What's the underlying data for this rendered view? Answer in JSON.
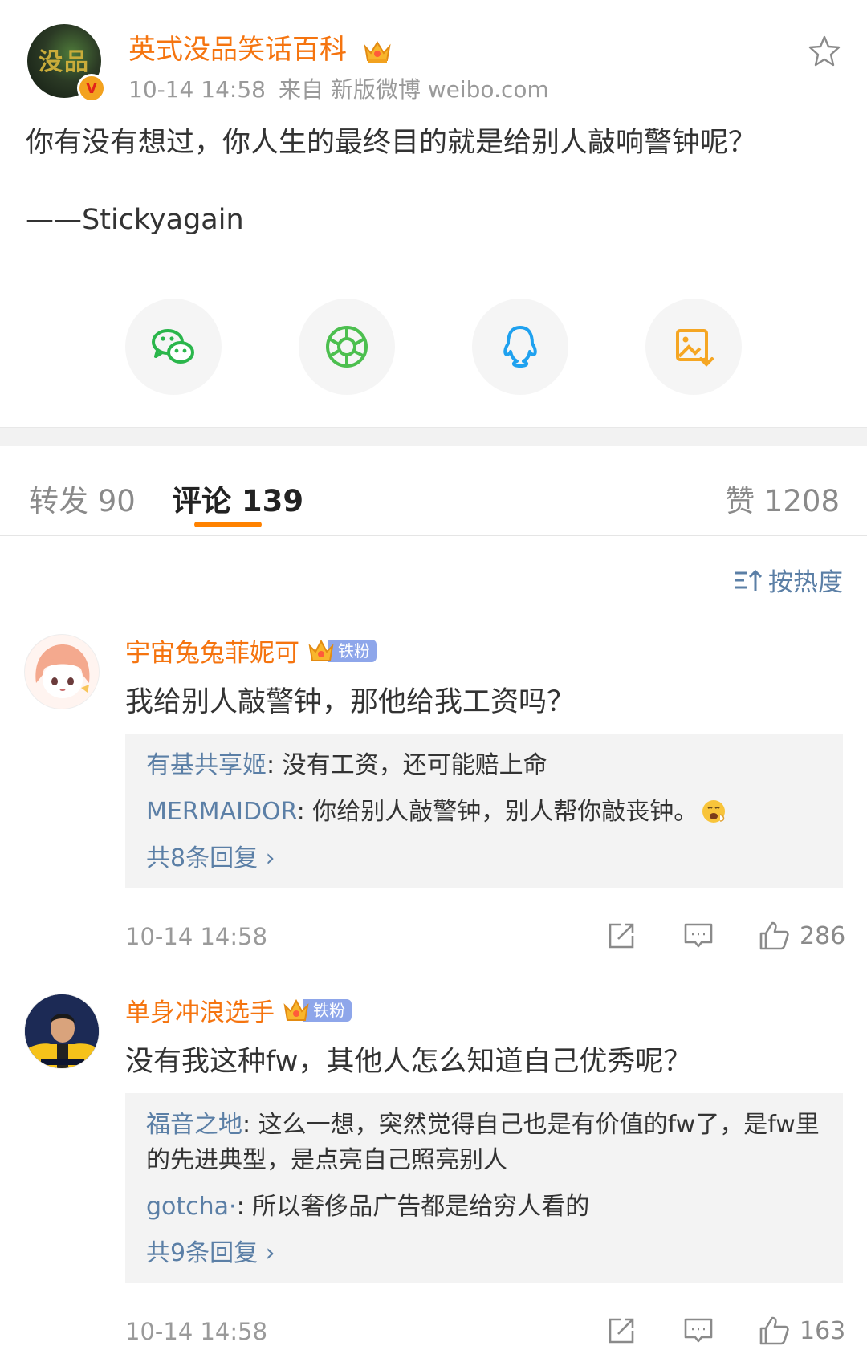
{
  "post": {
    "author": "英式没品笑话百科",
    "time": "10-14 14:58",
    "source": "来自 新版微博 weibo.com",
    "avatar_text": "没品",
    "text": "你有没有想过，你人生的最终目的就是给别人敲响警钟呢？",
    "signature": "——Stickyagain"
  },
  "share": {
    "items": [
      {
        "name": "wechat",
        "icon": "wechat-icon",
        "color": "#2ab64b"
      },
      {
        "name": "moments",
        "icon": "wechat-moments-icon",
        "color": "#4cbf4f"
      },
      {
        "name": "qq",
        "icon": "qq-icon",
        "color": "#1fa1ef"
      },
      {
        "name": "save-image",
        "icon": "save-image-icon",
        "color": "#f5a623"
      }
    ]
  },
  "tabs": {
    "repost": "转发 90",
    "comments": "评论 139",
    "likes": "赞 1208"
  },
  "sort_label": "按热度",
  "comments": [
    {
      "user": "宇宙兔兔菲妮可",
      "badge": "铁粉",
      "text": "我给别人敲警钟，那他给我工资吗？",
      "replies": [
        {
          "name": "有基共享姬",
          "text": ": 没有工资，还可能赔上命"
        },
        {
          "name": "MERMAIDOR",
          "text": ": 你给别人敲警钟，别人帮你敲丧钟。"
        }
      ],
      "more": "共8条回复 ›",
      "time": "10-14 14:58",
      "likes": "286"
    },
    {
      "user": "单身冲浪选手",
      "badge": "铁粉",
      "text": "没有我这种fw，其他人怎么知道自己优秀呢？",
      "replies": [
        {
          "name": "福音之地",
          "text": ": 这么一想，突然觉得自己也是有价值的fw了，是fw里的先进典型，是点亮自己照亮别人"
        },
        {
          "name": "gotcha·",
          "text": ": 所以奢侈品广告都是给穷人看的"
        }
      ],
      "more": "共9条回复 ›",
      "time": "10-14 14:58",
      "likes": "163"
    }
  ],
  "colors": {
    "accent": "#ff8200",
    "username": "#f5740f",
    "link": "#5b7fa6",
    "fan_badge": "#8ea6ea"
  }
}
